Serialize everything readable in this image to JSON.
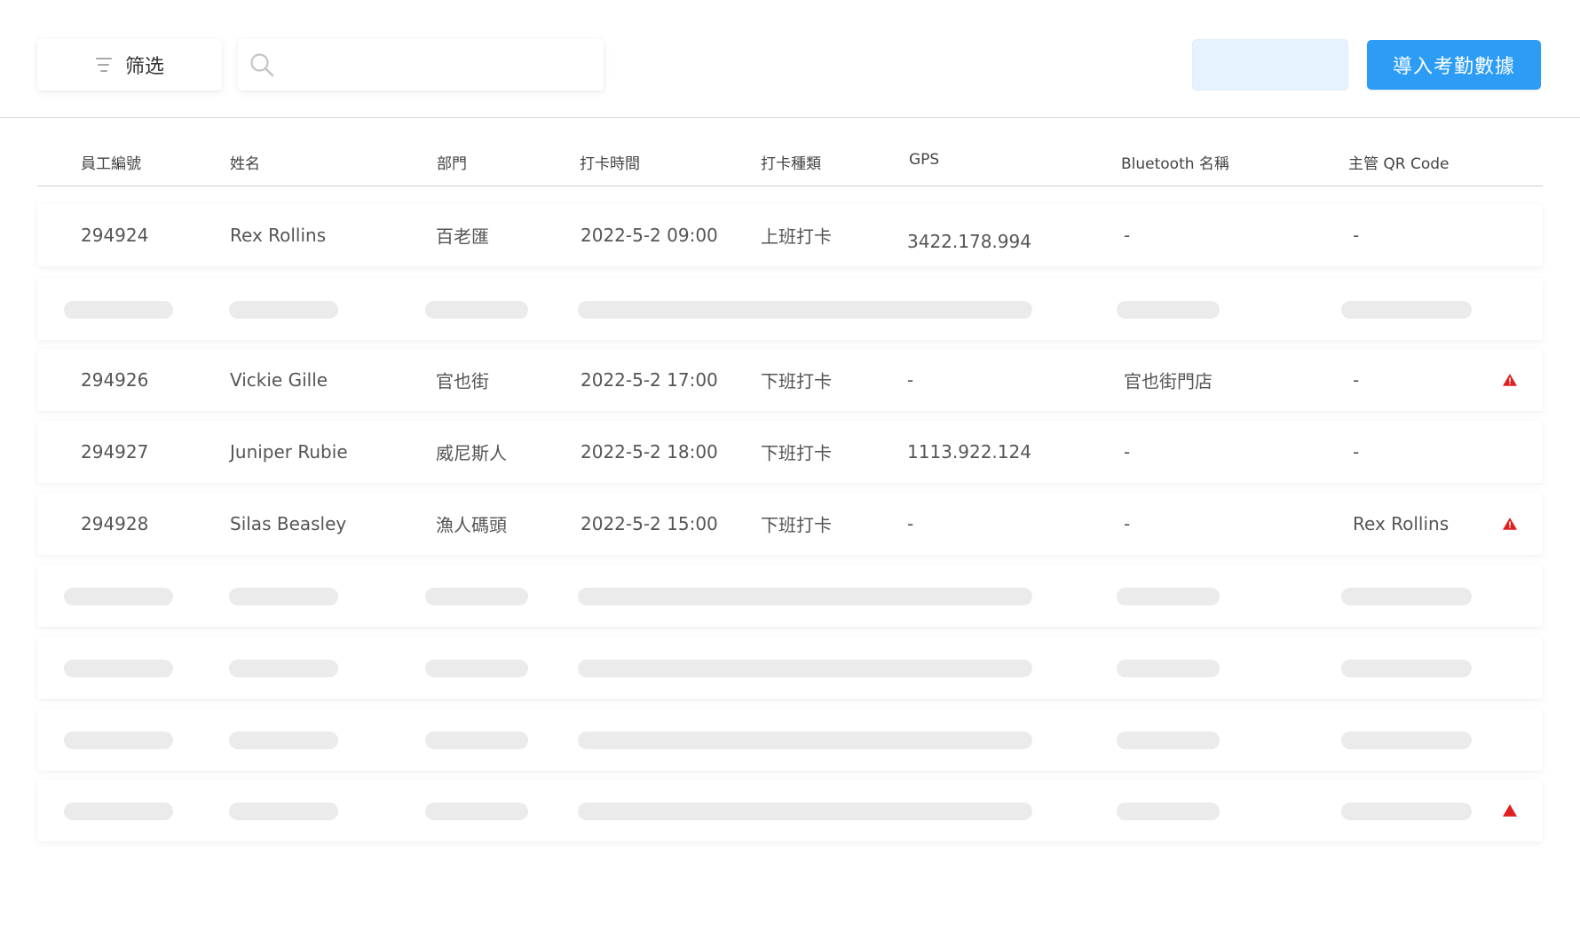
{
  "toolbar": {
    "filter_label": "筛选",
    "search_placeholder": "",
    "secondary_button_label": "",
    "import_button_label": "導入考勤數據"
  },
  "table": {
    "headers": [
      "員工編號",
      "姓名",
      "部門",
      "打卡時間",
      "打卡種類",
      "GPS",
      "Bluetooth 名稱",
      "主管 QR Code"
    ],
    "rows": [
      {
        "id": "294924",
        "name": "Rex Rollins",
        "dept": "百老匯",
        "time": "2022-5-2 09:00",
        "type": "上班打卡",
        "gps": "3422.178.994",
        "bluetooth": "-",
        "qr": "-",
        "warning": false
      },
      {
        "id": "294926",
        "name": "Vickie Gille",
        "dept": "官也街",
        "time": "2022-5-2 17:00",
        "type": "下班打卡",
        "gps": "-",
        "bluetooth": "官也街門店",
        "qr": "-",
        "warning": true
      },
      {
        "id": "294927",
        "name": "Juniper Rubie",
        "dept": "威尼斯人",
        "time": "2022-5-2 18:00",
        "type": "下班打卡",
        "gps": "1113.922.124",
        "bluetooth": "-",
        "qr": "-",
        "warning": false
      },
      {
        "id": "294928",
        "name": "Silas Beasley",
        "dept": "漁人碼頭",
        "time": "2022-5-2 15:00",
        "type": "下班打卡",
        "gps": "-",
        "bluetooth": "-",
        "qr": "Rex Rollins",
        "warning": true
      }
    ],
    "skeleton_rows": [
      {
        "warning": false
      },
      {
        "warning": false
      },
      {
        "warning": false
      },
      {
        "warning": false
      },
      {
        "warning": true
      }
    ]
  },
  "colors": {
    "primary": "#2c9cf5",
    "secondary_button_bg": "#e6f3fe",
    "warning": "#e02020",
    "skeleton": "#ebebeb"
  },
  "icons": {
    "filter": "filter-icon",
    "search": "search-icon",
    "warning": "warning-icon"
  }
}
